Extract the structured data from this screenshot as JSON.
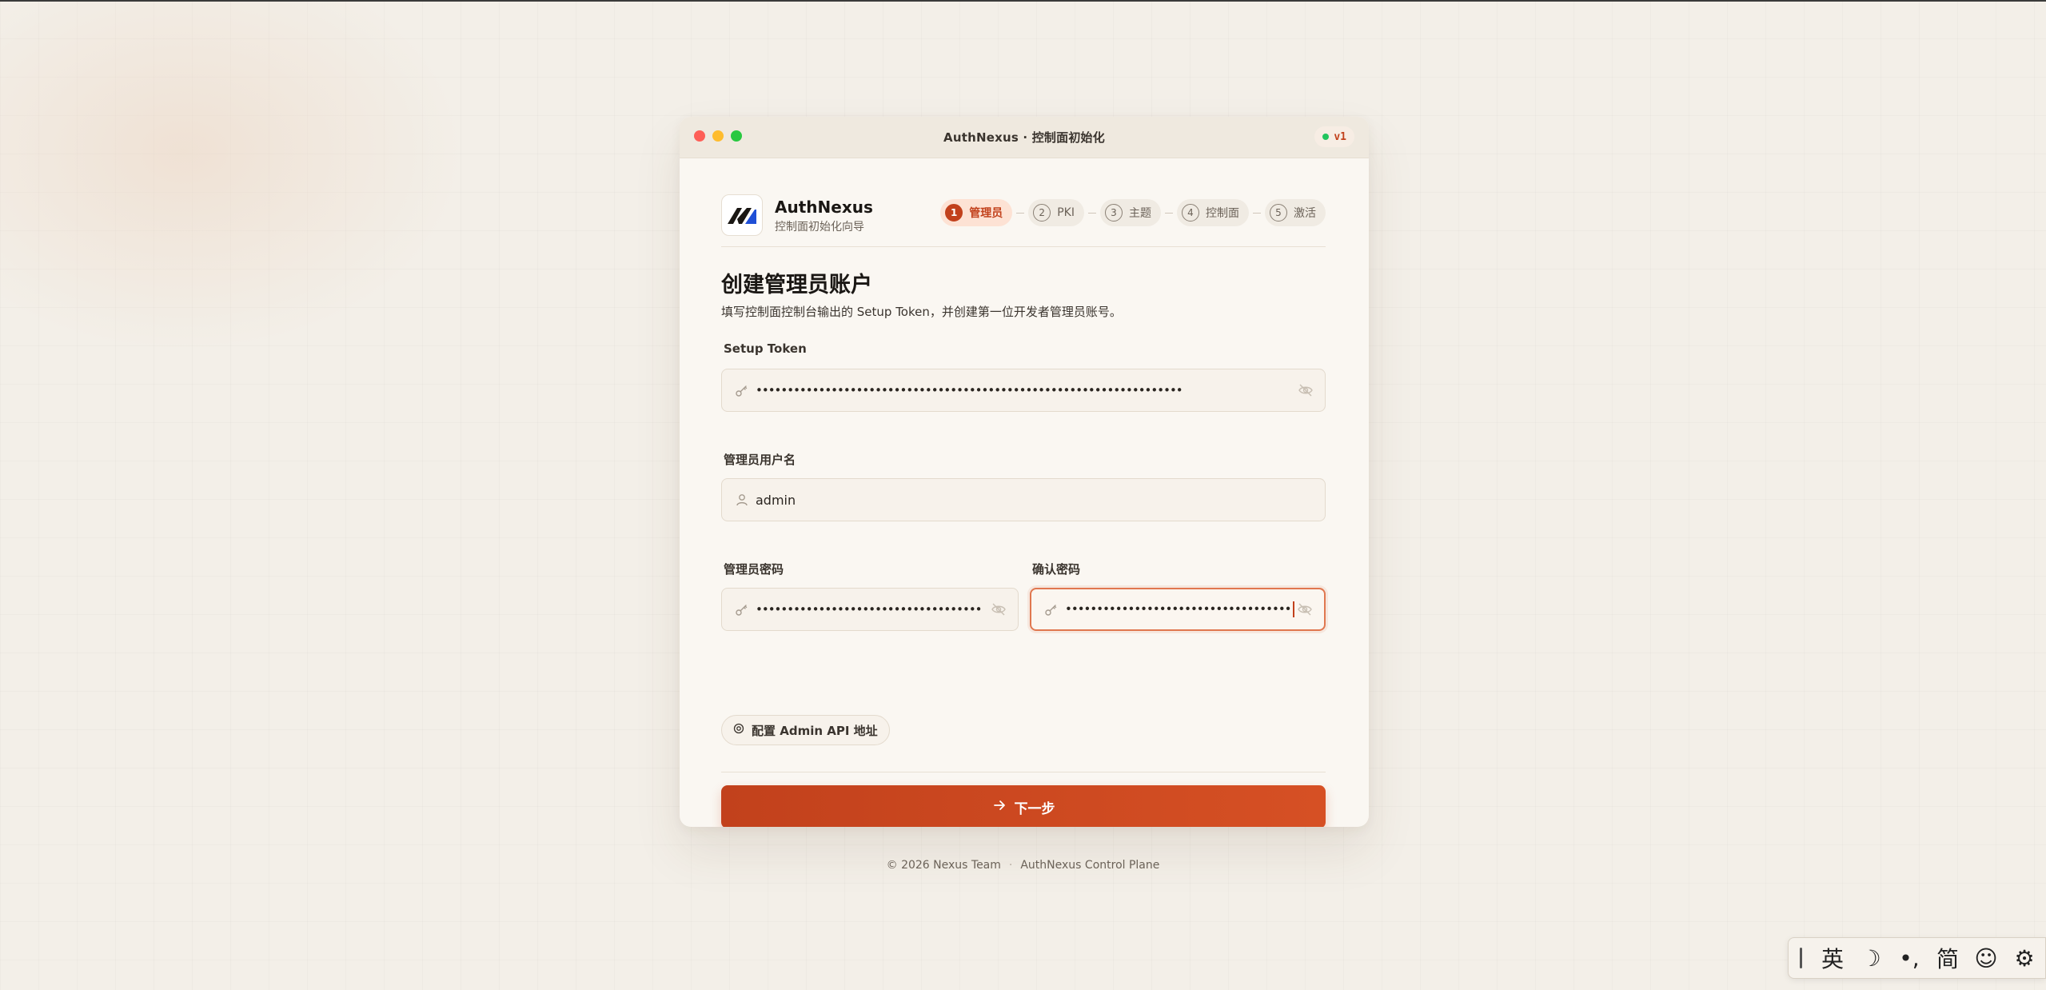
{
  "window": {
    "title": "AuthNexus · 控制面初始化",
    "version": "v1"
  },
  "brand": {
    "name": "AuthNexus",
    "subtitle": "控制面初始化向导"
  },
  "stepper": {
    "steps": [
      {
        "num": "1",
        "label": "管理员",
        "active": true
      },
      {
        "num": "2",
        "label": "PKI"
      },
      {
        "num": "3",
        "label": "主题"
      },
      {
        "num": "4",
        "label": "控制面"
      },
      {
        "num": "5",
        "label": "激活"
      }
    ]
  },
  "page": {
    "title": "创建管理员账户",
    "description": "填写控制面控制台输出的 Setup Token，并创建第一位开发者管理员账号。"
  },
  "form": {
    "setup_token": {
      "label": "Setup Token",
      "masked_value": "••••••••••••••••••••••••••••••••••••••••••••••••••••••••••••••••••••"
    },
    "username": {
      "label": "管理员用户名",
      "value": "admin"
    },
    "password": {
      "label": "管理员密码",
      "masked_value": "••••••••••••••••••••••••••••••••••••"
    },
    "confirm_password": {
      "label": "确认密码",
      "masked_value": "••••••••••••••••••••••••••••••••••••"
    }
  },
  "api_config": {
    "label": "配置 Admin API 地址"
  },
  "next_button": {
    "label": "下一步"
  },
  "footer": {
    "copyright": "© 2026 Nexus Team",
    "separator": "·",
    "product": "AuthNexus Control Plane"
  },
  "ime_toolbar": {
    "items": [
      "英",
      "☽",
      "•,",
      "简",
      "☺",
      "⚙"
    ]
  },
  "colors": {
    "accent": "#c2411c",
    "background": "#f3efe8",
    "status": "#22c55e"
  }
}
